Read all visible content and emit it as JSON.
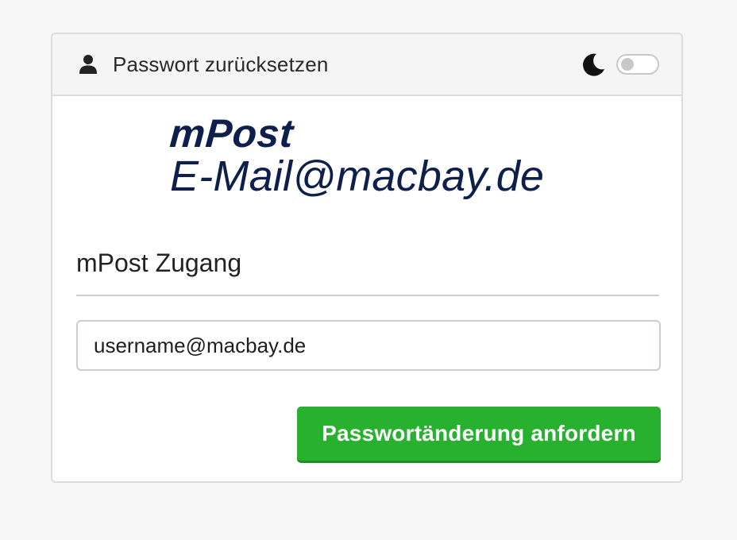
{
  "header": {
    "title": "Passwort zurücksetzen",
    "user_icon": "user-icon",
    "theme_icon": "moon-icon",
    "dark_mode_enabled": false
  },
  "logo": {
    "brand": "mPost",
    "domain": "E-Mail@macbay.de"
  },
  "form": {
    "section_title": "mPost Zugang",
    "username_value": "username@macbay.de",
    "submit_label": "Passwortänderung anfordern"
  },
  "colors": {
    "brand_navy": "#0d1f4a",
    "button_green": "#28b12f",
    "header_bg": "#f5f5f5"
  }
}
